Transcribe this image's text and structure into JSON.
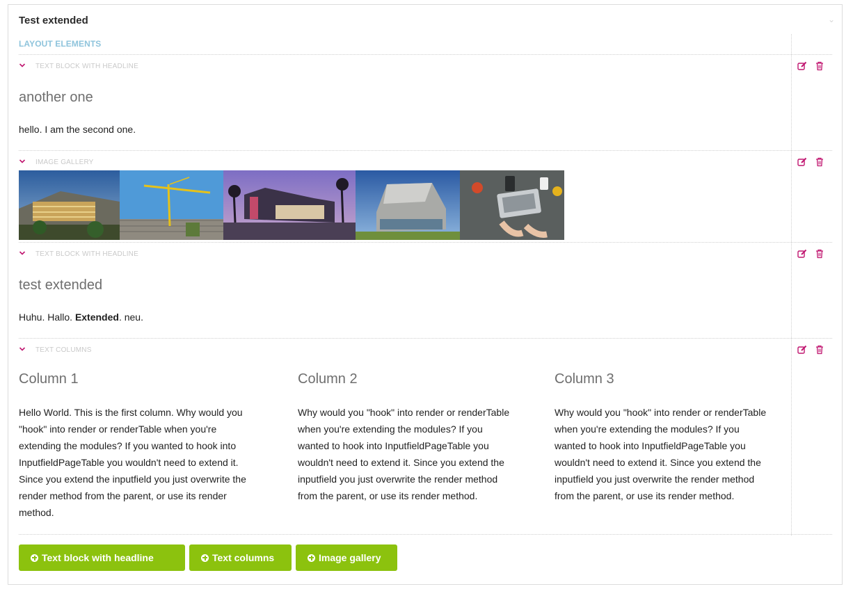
{
  "panel": {
    "title": "Test extended",
    "layout_heading": "LAYOUT ELEMENTS"
  },
  "colors": {
    "accent_button": "#8cc20e",
    "action_icon": "#c0156f",
    "layout_heading": "#8fc4dc"
  },
  "rows": [
    {
      "type": "TEXT BLOCK WITH HEADLINE",
      "headline": "another one",
      "body": "hello. I am the second one.",
      "actions": [
        "edit-icon",
        "trash-icon"
      ]
    },
    {
      "type": "IMAGE GALLERY",
      "images": [
        "office-building-photo",
        "construction-crane-photo",
        "museum-at-dusk-photo",
        "modern-glass-building-photo",
        "laptop-desk-photo"
      ],
      "actions": [
        "edit-icon",
        "trash-icon"
      ]
    },
    {
      "type": "TEXT BLOCK WITH HEADLINE",
      "headline": "test extended",
      "body_before": "Huhu. Hallo.",
      "body_bold": "Extended",
      "body_after": ". neu.",
      "actions": [
        "edit-icon",
        "trash-icon"
      ]
    },
    {
      "type": "TEXT COLUMNS",
      "columns": [
        {
          "title": "Column 1",
          "text": "Hello World. This is the first column. Why would you \"hook\" into render or renderTable when you're extending the modules? If you wanted to hook into InputfieldPageTable you wouldn't need to extend it. Since you extend the inputfield you just overwrite the render method from the parent, or use its render method."
        },
        {
          "title": "Column 2",
          "text": "Why would you \"hook\" into render or renderTable when you're extending the modules? If you wanted to hook into InputfieldPageTable you wouldn't need to extend it. Since you extend the inputfield you just overwrite the render method from the parent, or use its render method."
        },
        {
          "title": "Column 3",
          "text": "Why would you \"hook\" into render or renderTable when you're extending the modules? If you wanted to hook into InputfieldPageTable you wouldn't need to extend it. Since you extend the inputfield you just overwrite the render method from the parent, or use its render method."
        }
      ],
      "actions": [
        "edit-icon",
        "trash-icon"
      ]
    }
  ],
  "buttons": [
    {
      "label": "Text block with headline",
      "icon": "plus-circle-icon"
    },
    {
      "label": "Text columns",
      "icon": "plus-circle-icon"
    },
    {
      "label": "Image gallery",
      "icon": "plus-circle-icon"
    }
  ]
}
